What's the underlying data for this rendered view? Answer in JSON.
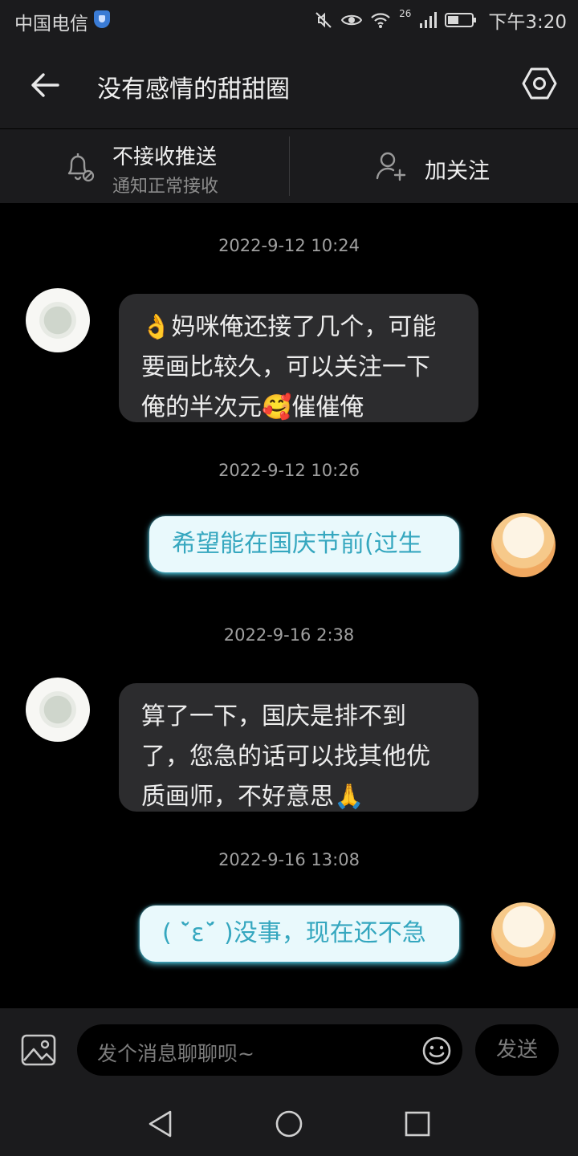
{
  "status_bar": {
    "carrier": "中国电信",
    "network": "26",
    "time": "下午3:20",
    "icons": [
      "shield-icon",
      "mute-icon",
      "eye-icon",
      "wifi-icon",
      "signal-icon",
      "battery-icon"
    ]
  },
  "header": {
    "title": "没有感情的甜甜圈",
    "icons": [
      "back-arrow-icon",
      "settings-icon"
    ]
  },
  "subbar": {
    "push_title": "不接收推送",
    "push_subtitle": "通知正常接收",
    "follow_label": "加关注",
    "icons": [
      "bell-off-icon",
      "user-plus-icon"
    ]
  },
  "messages": [
    {
      "timestamp": "2022-9-12 10:24",
      "sender": "other",
      "lines": [
        "👌妈咪俺还接了几个，可能",
        "要画比较久，可以关注一下",
        "俺的半次元🥰催催俺"
      ]
    },
    {
      "timestamp": "2022-9-12 10:26",
      "sender": "self",
      "lines": [
        "希望能在国庆节前(过生"
      ]
    },
    {
      "timestamp": "2022-9-16 2:38",
      "sender": "other",
      "lines": [
        "算了一下，国庆是排不到",
        "了，您急的话可以找其他优",
        "质画师，不好意思🙏"
      ]
    },
    {
      "timestamp": "2022-9-16 13:08",
      "sender": "self",
      "lines": [
        "( ˘̀ε˘́ )没事，现在还不急"
      ]
    }
  ],
  "composer": {
    "placeholder": "发个消息聊聊呗~",
    "send_label": "发送",
    "icons": [
      "image-icon",
      "emoji-icon"
    ]
  },
  "navbar": {
    "icons": [
      "nav-back-icon",
      "nav-home-icon",
      "nav-recents-icon"
    ]
  },
  "colors": {
    "background": "#000000",
    "bar": "#1b1b1d",
    "incoming_bubble": "#2c2c2e",
    "outgoing_bubble": "#e9f9fc",
    "outgoing_text": "#35a7bf",
    "outgoing_glow": "#50d2eb"
  }
}
